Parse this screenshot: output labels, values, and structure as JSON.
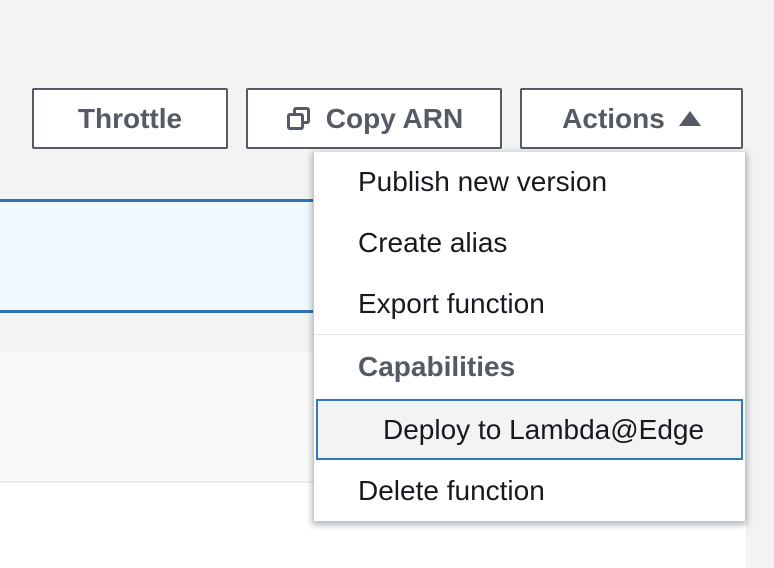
{
  "toolbar": {
    "throttle_label": "Throttle",
    "copy_arn_label": "Copy ARN",
    "actions_label": "Actions",
    "actions_state": "expanded"
  },
  "menu": {
    "items": [
      {
        "label": "Publish new version",
        "type": "item"
      },
      {
        "label": "Create alias",
        "type": "item"
      },
      {
        "label": "Export function",
        "type": "item"
      },
      {
        "label": "Capabilities",
        "type": "group-header"
      },
      {
        "label": "Deploy to Lambda@Edge",
        "type": "item",
        "highlighted": true
      },
      {
        "label": "Delete function",
        "type": "item"
      }
    ]
  },
  "icons": {
    "copy_button_icon": "copy-icon",
    "actions_button_icon": "caret-up-icon"
  },
  "colors": {
    "page_background": "#f2f3f3",
    "button_border_text": "#545b64",
    "menu_text": "#16191f",
    "group_header_text": "#545b64",
    "selected_row_fill": "#f0f7fd",
    "selected_row_border": "#2e74b5",
    "menu_highlight_border": "#3177b9",
    "menu_highlight_fill": "#f2f3f3"
  }
}
